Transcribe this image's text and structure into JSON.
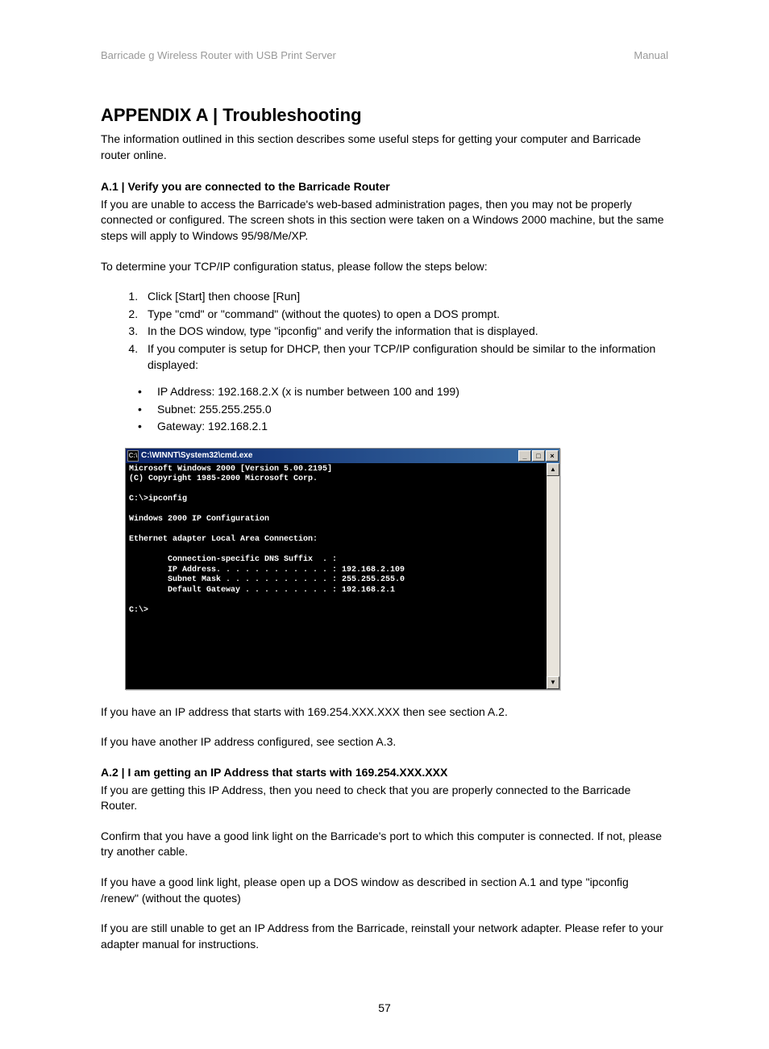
{
  "header": {
    "left": "Barricade g Wireless Router with USB Print Server",
    "right": "Manual"
  },
  "title": "APPENDIX A | Troubleshooting",
  "intro": "The information outlined in this section describes some useful steps for getting your computer and Barricade router online.",
  "a1": {
    "heading": "A.1 | Verify you are connected to the Barricade Router",
    "p1": "If you are unable to access the Barricade's web-based administration pages, then you may not be properly connected or configured. The screen shots in this section were taken on a Windows 2000 machine, but the same steps will apply to Windows 95/98/Me/XP.",
    "p2": "To determine your TCP/IP configuration status, please follow the steps below:",
    "steps": [
      "Click [Start] then choose [Run]",
      "Type \"cmd\" or \"command\" (without the quotes) to open a DOS prompt.",
      "In the DOS window, type \"ipconfig\" and verify the information that is displayed.",
      "If you computer is setup for DHCP, then your TCP/IP configuration should be similar to the information displayed:"
    ],
    "bullets": [
      "IP Address: 192.168.2.X (x is number between 100 and 199)",
      "Subnet: 255.255.255.0",
      "Gateway: 192.168.2.1"
    ],
    "after1": "If you have an IP address that starts with 169.254.XXX.XXX then see section A.2.",
    "after2": "If you have another IP address configured, see section A.3."
  },
  "cmd": {
    "title": "C:\\WINNT\\System32\\cmd.exe",
    "btn_min": "_",
    "btn_max": "□",
    "btn_close": "×",
    "line1": "Microsoft Windows 2000 [Version 5.00.2195]",
    "line2": "(C) Copyright 1985-2000 Microsoft Corp.",
    "line3": "C:\\>ipconfig",
    "line4": "Windows 2000 IP Configuration",
    "line5": "Ethernet adapter Local Area Connection:",
    "line6": "        Connection-specific DNS Suffix  . :",
    "line7": "        IP Address. . . . . . . . . . . . : 192.168.2.109",
    "line8": "        Subnet Mask . . . . . . . . . . . : 255.255.255.0",
    "line9": "        Default Gateway . . . . . . . . . : 192.168.2.1",
    "line10": "C:\\>"
  },
  "a2": {
    "heading": "A.2 | I am getting an IP Address that starts with 169.254.XXX.XXX",
    "p1": "If you are getting this IP Address, then you need to check that you are properly connected to the Barricade Router.",
    "p2": "Confirm that you have a good link light on the Barricade's port to which this computer is connected.  If not, please try another cable.",
    "p3": "If you have a good link light, please open up a DOS window as described in section A.1 and type \"ipconfig /renew\" (without the quotes)",
    "p4": "If you are still unable to get an IP Address from the Barricade, reinstall your network adapter. Please refer to your adapter manual for instructions."
  },
  "page_number": "57"
}
